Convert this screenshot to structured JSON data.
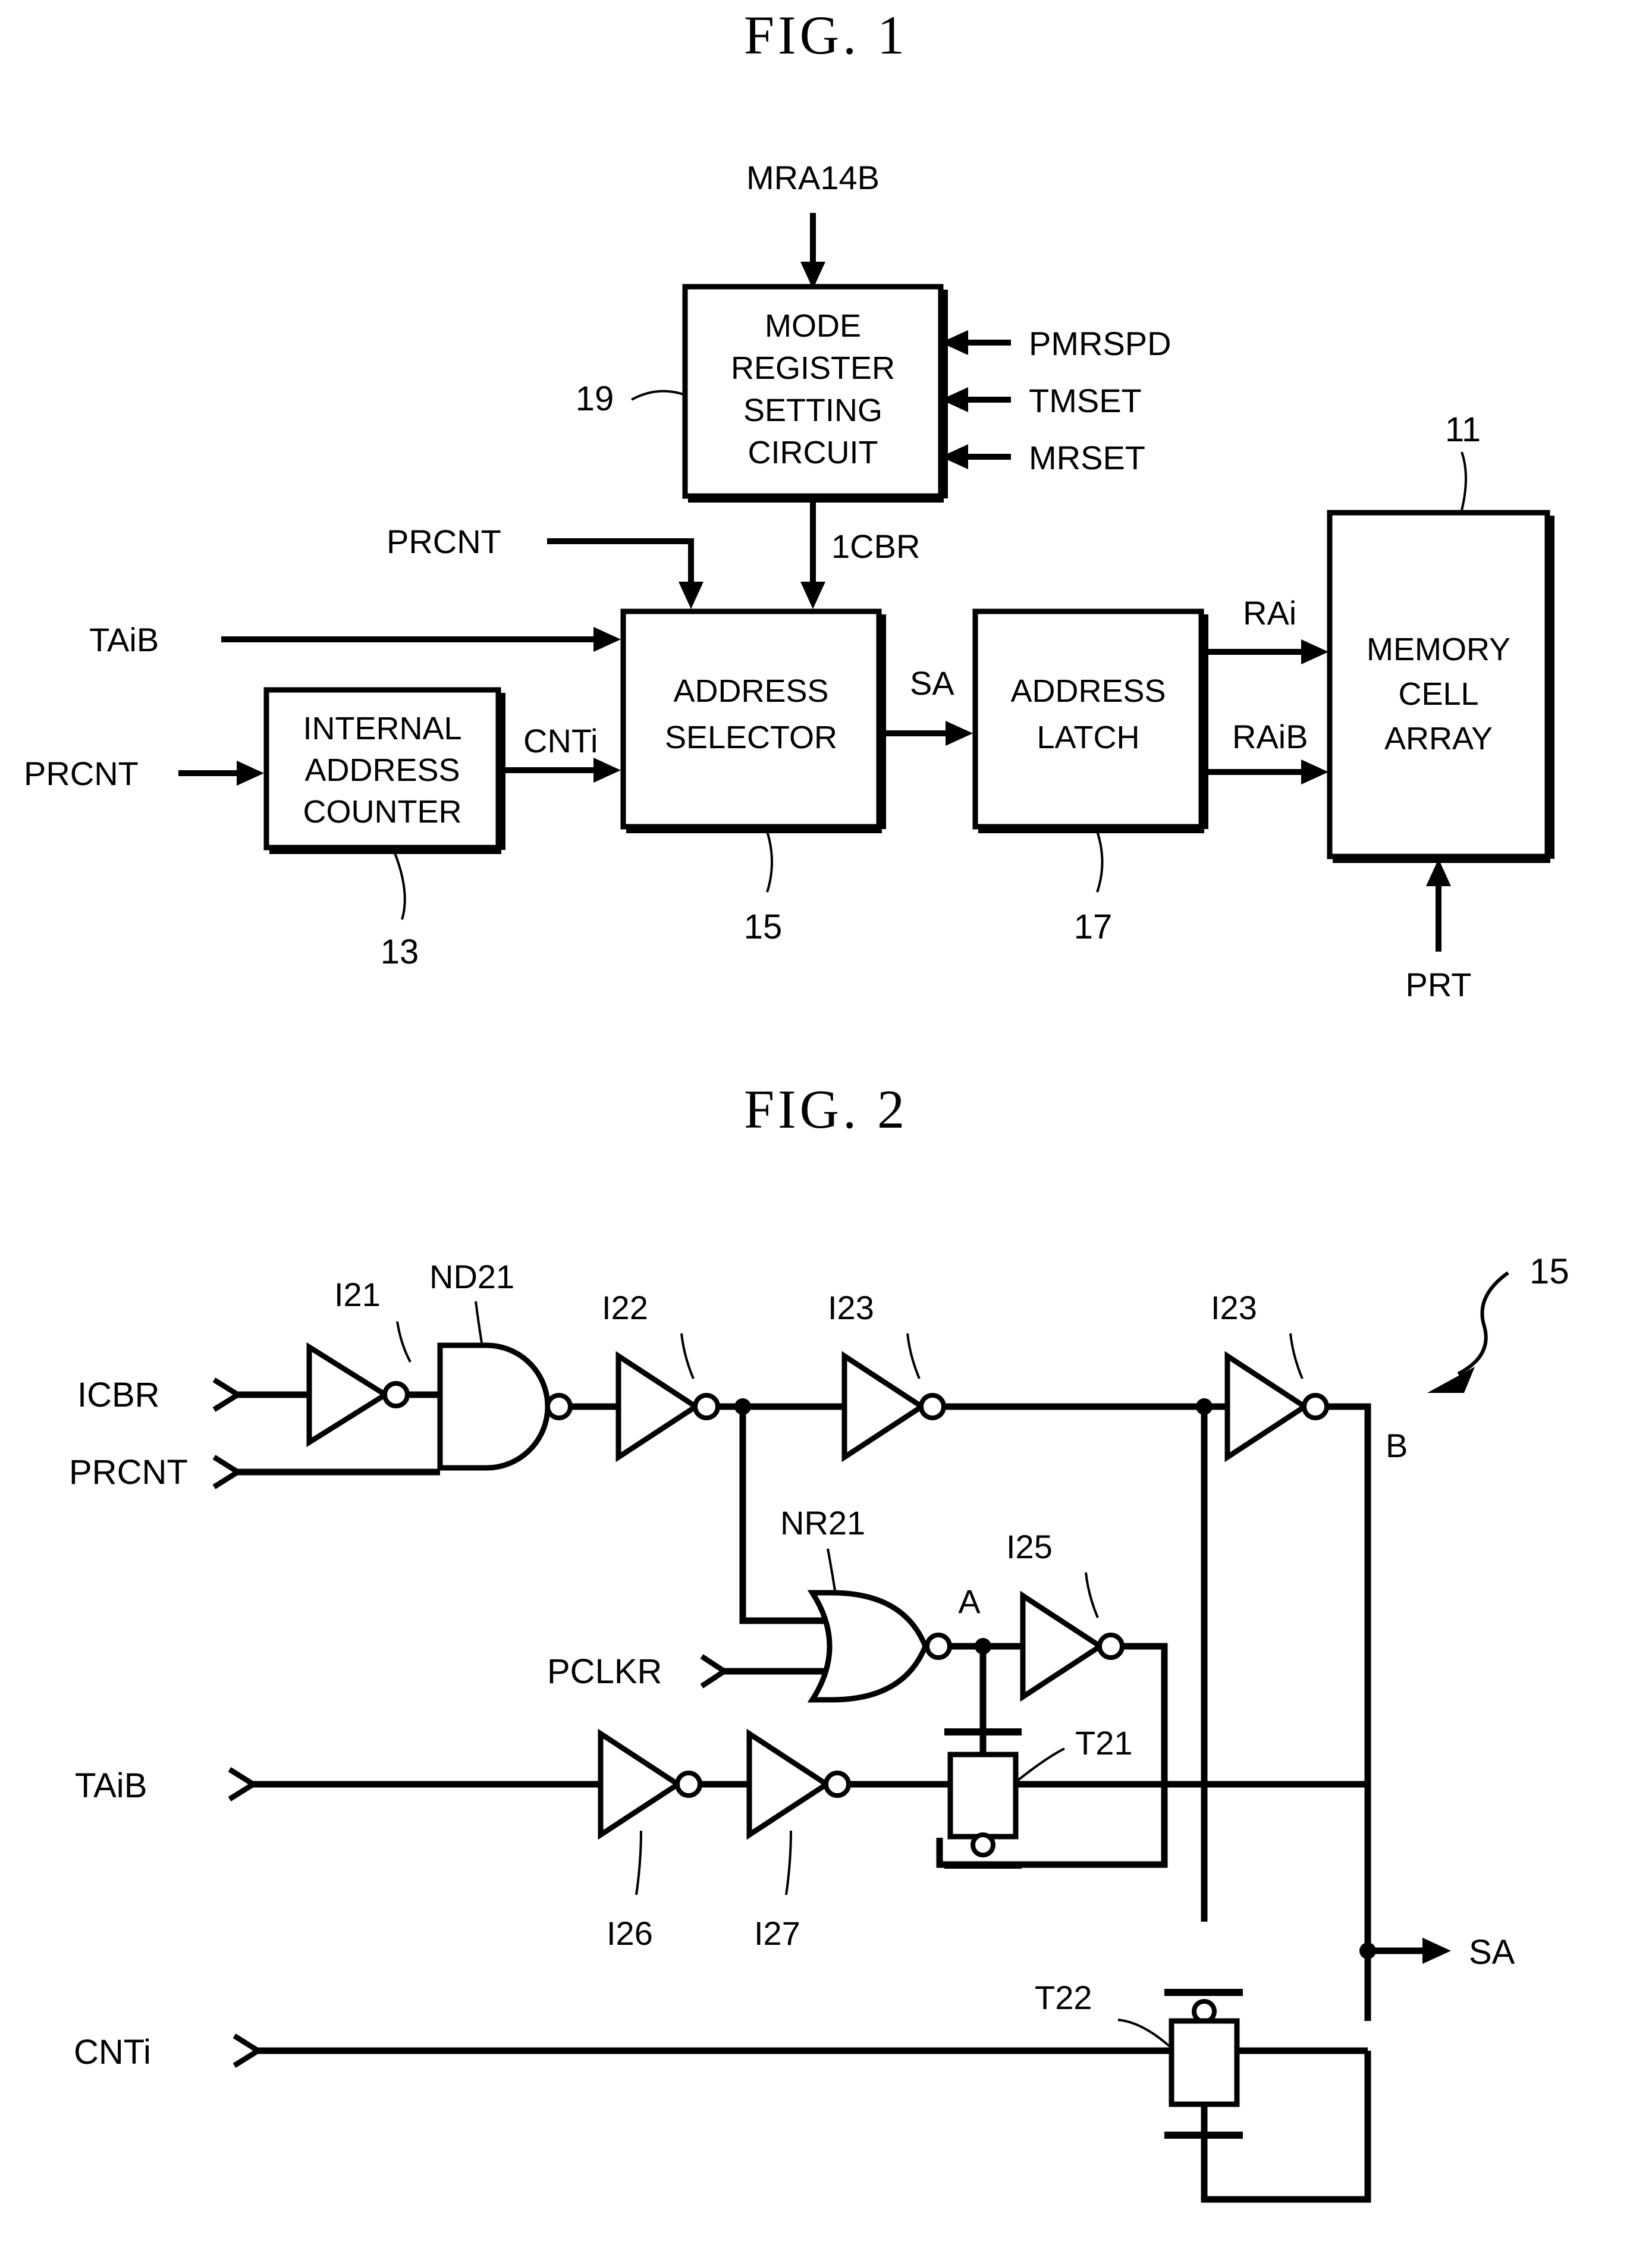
{
  "figures": [
    {
      "id": "fig1",
      "title": "FIG.  1",
      "blocks": [
        {
          "key": "mode_register",
          "lines": [
            "MODE",
            "REGISTER",
            "SETTING",
            "CIRCUIT"
          ],
          "ref": "19"
        },
        {
          "key": "internal_counter",
          "lines": [
            "INTERNAL",
            "ADDRESS",
            "COUNTER"
          ],
          "ref": "13"
        },
        {
          "key": "address_selector",
          "lines": [
            "ADDRESS",
            "SELECTOR"
          ],
          "ref": "15"
        },
        {
          "key": "address_latch",
          "lines": [
            "ADDRESS",
            "LATCH"
          ],
          "ref": "17"
        },
        {
          "key": "memory_cell_array",
          "lines": [
            "MEMORY",
            "CELL",
            "ARRAY"
          ],
          "ref": "11"
        }
      ],
      "signals": {
        "mra14b": "MRA14B",
        "pmrspd": "PMRSPD",
        "tmset": "TMSET",
        "mrset": "MRSET",
        "icbr": "1CBR",
        "prcnt_top": "PRCNT",
        "taib": "TAiB",
        "prcnt_left": "PRCNT",
        "cnti": "CNTi",
        "sa": "SA",
        "rai": "RAi",
        "raib": "RAiB",
        "prt": "PRT"
      },
      "refs": {
        "mode_register": "19",
        "internal_counter": "13",
        "address_selector": "15",
        "address_latch": "17",
        "memory_cell_array": "11"
      }
    },
    {
      "id": "fig2",
      "title": "FIG.  2",
      "signals": {
        "icbr": "ICBR",
        "prcnt": "PRCNT",
        "pclkr": "PCLKR",
        "taib": "TAiB",
        "cnti": "CNTi",
        "sa": "SA",
        "node_a": "A",
        "node_b": "B"
      },
      "components": {
        "i21": "I21",
        "nd21": "ND21",
        "i22": "I22",
        "i23_left": "I23",
        "i23_right": "I23",
        "nr21": "NR21",
        "i25": "I25",
        "i26": "I26",
        "i27": "I27",
        "t21": "T21",
        "t22": "T22"
      },
      "refs": {
        "circuit": "15"
      }
    }
  ],
  "colors": {
    "ink": "#000000",
    "paper": "#ffffff"
  }
}
